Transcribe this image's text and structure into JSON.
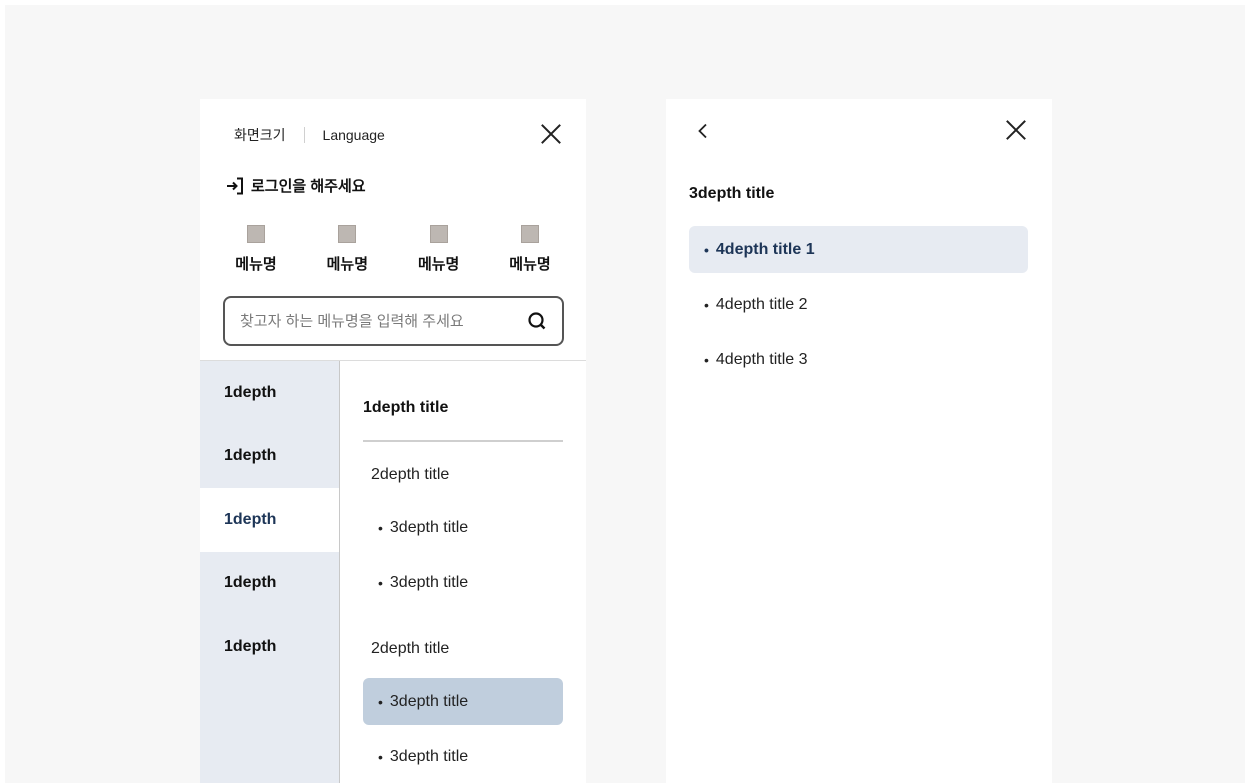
{
  "left_panel": {
    "top_links": {
      "screen_size": "화면크기",
      "language": "Language"
    },
    "login_text": "로그인을 해주세요",
    "quick_menu": [
      {
        "label": "메뉴명"
      },
      {
        "label": "메뉴명"
      },
      {
        "label": "메뉴명"
      },
      {
        "label": "메뉴명"
      }
    ],
    "search": {
      "placeholder": "찾고자 하는 메뉴명을 입력해 주세요"
    },
    "depth1_items": [
      {
        "label": "1depth"
      },
      {
        "label": "1depth"
      },
      {
        "label": "1depth"
      },
      {
        "label": "1depth"
      },
      {
        "label": "1depth"
      }
    ],
    "depth_content": {
      "title": "1depth title",
      "group1_title": "2depth title",
      "group1_items": [
        "3depth title",
        "3depth title"
      ],
      "group2_title": "2depth title",
      "group2_items": [
        "3depth title",
        "3depth title"
      ]
    }
  },
  "right_panel": {
    "title": "3depth title",
    "items": [
      "4depth title 1",
      "4depth title 2",
      "4depth title 3"
    ]
  },
  "colors": {
    "page_bg": "#f7f7f7",
    "depth1_bg": "#e7ebf2",
    "active_highlight": "#c0cedd",
    "active_text": "#1d3557"
  }
}
